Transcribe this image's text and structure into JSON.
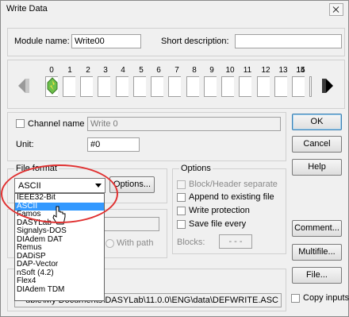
{
  "window": {
    "title": "Write Data"
  },
  "module": {
    "name_label": "Module name:",
    "name_value": "Write00",
    "desc_label": "Short description:",
    "desc_value": ""
  },
  "channels": {
    "numbers": [
      "0",
      "1",
      "2",
      "3",
      "4",
      "5",
      "6",
      "7",
      "8",
      "9",
      "10",
      "11",
      "12",
      "13",
      "14",
      "15"
    ]
  },
  "channel_name": {
    "label": "Channel name",
    "value": "Write 0"
  },
  "unit": {
    "label": "Unit:",
    "value": "#0"
  },
  "buttons": {
    "ok": "OK",
    "cancel": "Cancel",
    "help": "Help",
    "comment": "Comment...",
    "multifile": "Multifile...",
    "file": "File...",
    "options": "Options..."
  },
  "file_format": {
    "label": "File format",
    "selected": "ASCII",
    "options": [
      "IEEE32-Bit",
      "ASCII",
      "Famos",
      "DASYLab",
      "Signalys-DOS",
      "DIAdem DAT",
      "Remus",
      "DADiSP",
      "DAP-Vector",
      "nSoft (4.2)",
      "Flex4",
      "DIAdem TDM"
    ]
  },
  "options_group": {
    "label": "Options",
    "block_header": "Block/Header separate",
    "append": "Append to existing file",
    "write_protection": "Write protection",
    "save_every": "Save file every",
    "blocks_label": "Blocks:",
    "blocks_value": "- - -"
  },
  "with_path": "With path",
  "path": "uble\\My Documents\\DASYLab\\11.0.0\\ENG\\data\\DEFWRITE.ASC",
  "copy_inputs": "Copy inputs",
  "colors": {
    "selection": "#3399ff",
    "highlight_ellipse": "#e03030",
    "channel_icon": "#6cc04a"
  }
}
